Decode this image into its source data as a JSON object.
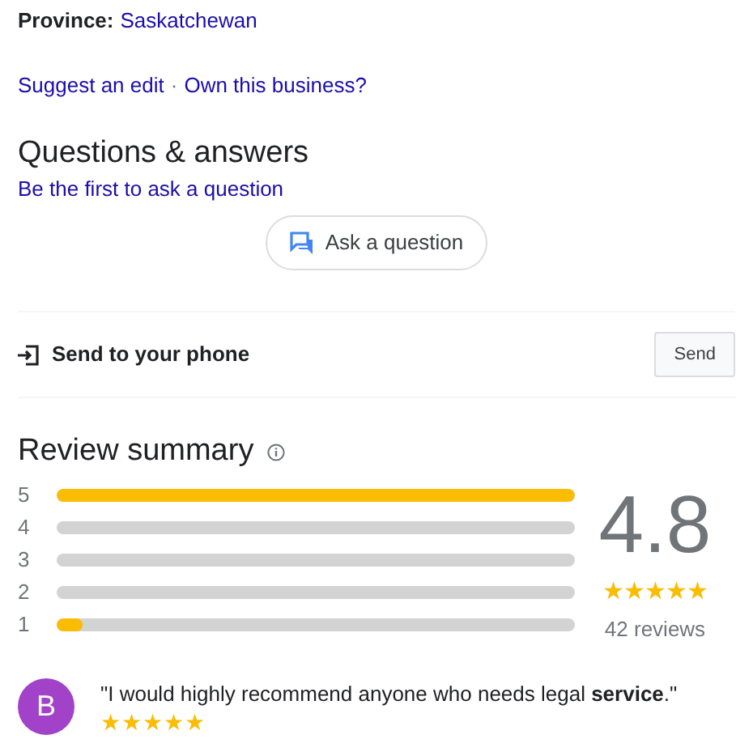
{
  "province": {
    "label": "Province:",
    "value": "Saskatchewan"
  },
  "edit_links": [
    {
      "kind": "link",
      "text": "Suggest an edit"
    },
    {
      "kind": "separator",
      "text": "·"
    },
    {
      "kind": "link",
      "text": "Own this business?"
    }
  ],
  "questions": {
    "title": "Questions & answers",
    "link": "Be the first to ask a question",
    "button": "Ask a question"
  },
  "send_to_phone": {
    "label": "Send to your phone",
    "button": "Send"
  },
  "review_summary": {
    "title": "Review summary",
    "bars": [
      {
        "label": "5",
        "level": 1.0
      },
      {
        "label": "4",
        "level": 0
      },
      {
        "label": "3",
        "level": 0
      },
      {
        "label": "2",
        "level": 0
      },
      {
        "label": "1",
        "level": 0.05
      }
    ],
    "rating": "4.8",
    "stars": 5,
    "count": "42 reviews"
  },
  "reviews": [
    {
      "initial": "B",
      "color": "#a142c8",
      "quote": "\"I would highly recommend anyone who needs legal **service**.\"",
      "stars": 5
    }
  ]
}
